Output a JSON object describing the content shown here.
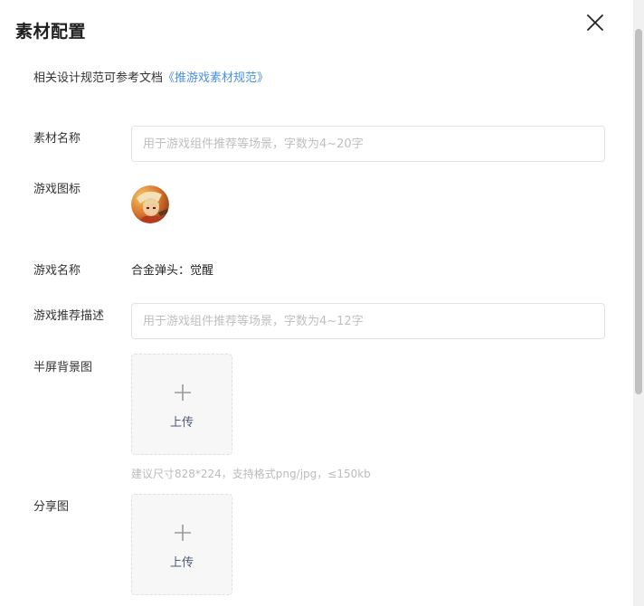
{
  "dialog": {
    "title": "素材配置",
    "tip_prefix": "相关设计规范可参考文档",
    "tip_link": "《推游戏素材规范》"
  },
  "form": {
    "material_name": {
      "label": "素材名称",
      "placeholder": "用于游戏组件推荐等场景，字数为4~20字",
      "value": ""
    },
    "game_icon": {
      "label": "游戏图标"
    },
    "game_name": {
      "label": "游戏名称",
      "value": "合金弹头：觉醒"
    },
    "game_desc": {
      "label": "游戏推荐描述",
      "placeholder": "用于游戏组件推荐等场景，字数为4~12字",
      "value": ""
    },
    "half_screen_bg": {
      "label": "半屏背景图",
      "upload_label": "上传",
      "hint": "建议尺寸828*224，支持格式png/jpg，≤150kb"
    },
    "share_image": {
      "label": "分享图",
      "upload_label": "上传"
    }
  },
  "colors": {
    "link": "#4a8fe0",
    "upload_bg": "#f7f7f7",
    "placeholder": "#bfbfbf"
  },
  "icons": {
    "close": "close-icon",
    "plus": "plus-icon"
  }
}
